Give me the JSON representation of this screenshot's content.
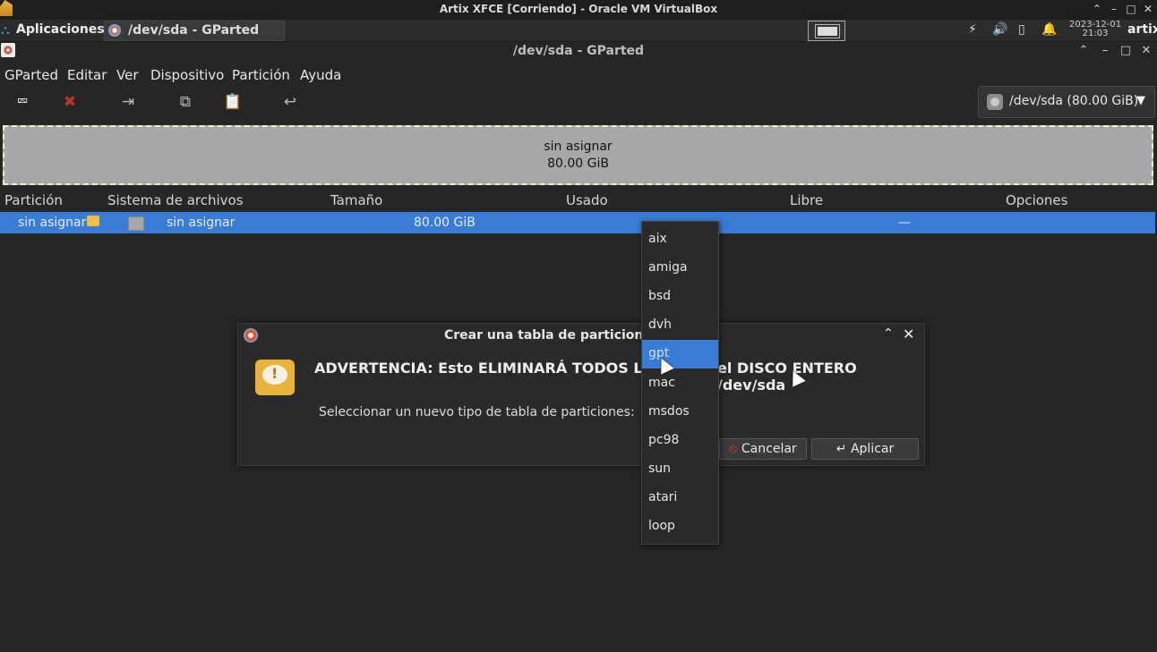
{
  "vbox": {
    "title": "Artix XFCE [Corriendo] - Oracle VM VirtualBox",
    "controls": {
      "collapse": "⌃",
      "minimize": "–",
      "maximize": "□",
      "close": "✕"
    }
  },
  "panel": {
    "apps_menu": "Aplicaciones",
    "task_title": "/dev/sda - GParted",
    "clock_date": "2023-12-01",
    "clock_time": "21:03",
    "user": "artix"
  },
  "window": {
    "title": "/dev/sda - GParted",
    "controls": {
      "collapse": "⌃",
      "minimize": "–",
      "maximize": "□",
      "close": "✕"
    }
  },
  "menubar": [
    "GParted",
    "Editar",
    "Ver",
    "Dispositivo",
    "Partición",
    "Ayuda"
  ],
  "toolbar": {
    "icons": [
      "new-partition-icon",
      "delete-icon",
      "resize-move-icon",
      "copy-icon",
      "paste-icon",
      "undo-icon"
    ],
    "device_label": "/dev/sda (80.00 GiB)"
  },
  "disk_map": {
    "line1": "sin asignar",
    "line2": "80.00 GiB"
  },
  "columns": [
    "Partición",
    "Sistema de archivos",
    "Tamaño",
    "Usado",
    "Libre",
    "Opciones"
  ],
  "rows": [
    {
      "partition": "sin asignar",
      "filesystem": "sin asignar",
      "size": "80.00 GiB",
      "used": "",
      "free": "",
      "options": "—"
    }
  ],
  "dialog": {
    "title": "Crear una tabla de particiones en",
    "heading_start": "ADVERTENCIA: Esto ELIMINARÁ TODOS LOS",
    "heading_end": "el DISCO ENTERO /dev/sda",
    "subtitle": "Seleccionar un nuevo tipo de tabla de particiones:",
    "cancel": "Cancelar",
    "apply": "Aplicar",
    "warn_mark": "!",
    "cancel_icon": "⦸",
    "apply_icon": "↵"
  },
  "dropdown": {
    "options": [
      "aix",
      "amiga",
      "bsd",
      "dvh",
      "gpt",
      "mac",
      "msdos",
      "pc98",
      "sun",
      "atari",
      "loop"
    ],
    "selected": "gpt"
  },
  "colors": {
    "selection": "#3a7bd5",
    "unallocated": "#a8a8a8",
    "warning": "#e8b23c"
  }
}
